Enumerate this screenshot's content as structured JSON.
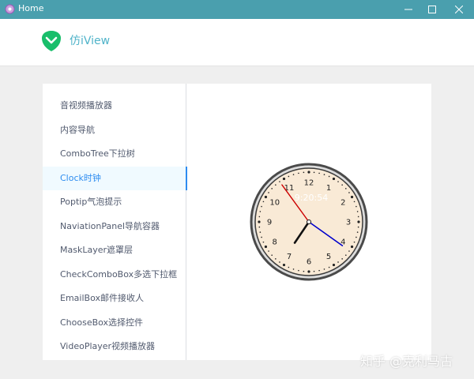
{
  "window": {
    "title": "Home",
    "accent": "#4a9fae",
    "controls": {
      "minimize": "minimize-icon",
      "maximize": "maximize-icon",
      "close": "close-icon"
    }
  },
  "header": {
    "brand": "仿iView",
    "logo_icon": "leaf-shield-icon"
  },
  "sidebar": {
    "active_index": 3,
    "items": [
      {
        "label": "音视频播放器"
      },
      {
        "label": "内容导航"
      },
      {
        "label": "ComboTree下拉树"
      },
      {
        "label": "Clock时钟"
      },
      {
        "label": "Poptip气泡提示"
      },
      {
        "label": "NaviationPanel导航容器"
      },
      {
        "label": "MaskLayer遮罩层"
      },
      {
        "label": "CheckComboBox多选下拉框"
      },
      {
        "label": "EmailBox邮件接收人"
      },
      {
        "label": "ChooseBox选择控件"
      },
      {
        "label": "VideoPlayer视频播放器"
      }
    ]
  },
  "clock": {
    "digital": "9:20:54",
    "hour": 9,
    "minute": 20,
    "second": 54,
    "numerals": [
      "12",
      "1",
      "2",
      "3",
      "4",
      "5",
      "6",
      "7",
      "8",
      "9",
      "10",
      "11"
    ],
    "colors": {
      "face": "#f9ead6",
      "rim": "#4a4a4a",
      "hour_hand": "#111111",
      "minute_hand": "#0000cc",
      "second_hand": "#cc0000"
    }
  },
  "watermark": "知乎 @克利马古"
}
